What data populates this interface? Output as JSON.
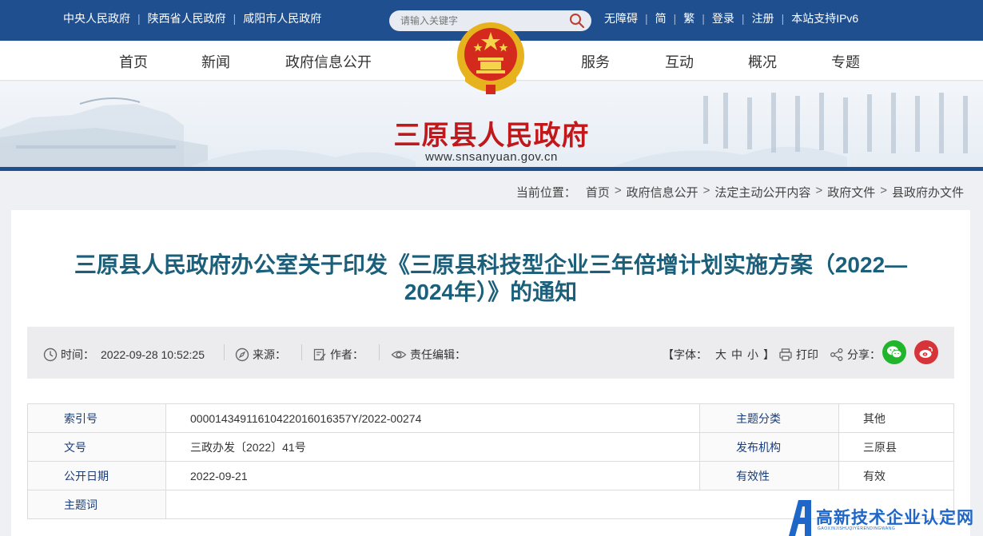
{
  "top_links": [
    "中央人民政府",
    "陕西省人民政府",
    "咸阳市人民政府"
  ],
  "search": {
    "placeholder": "请输入关键字"
  },
  "right_links": [
    "无障碍",
    "简",
    "繁",
    "登录",
    "注册",
    "本站支持IPv6"
  ],
  "nav": {
    "left": [
      "首页",
      "新闻",
      "政府信息公开"
    ],
    "right": [
      "服务",
      "互动",
      "概况",
      "专题"
    ]
  },
  "banner": {
    "title": "三原县人民政府",
    "url": "www.snsanyuan.gov.cn"
  },
  "breadcrumb": {
    "label": "当前位置：",
    "items": [
      "首页",
      "政府信息公开",
      "法定主动公开内容",
      "政府文件",
      "县政府办文件"
    ]
  },
  "article": {
    "title_line1": "三原县人民政府办公室关于印发《三原县科技型企业三年倍增计划实施方案（2022—",
    "title_line2": "2024年）》的通知"
  },
  "meta": {
    "time_label": "时间：",
    "time_value": "2022-09-28 10:52:25",
    "source_label": "来源：",
    "author_label": "作者：",
    "editor_label": "责任编辑：",
    "font_label": "【字体：",
    "font_sizes": [
      "大",
      "中",
      "小"
    ],
    "font_close": "】",
    "print_label": "打印",
    "share_label": "分享："
  },
  "info_table": [
    {
      "label": "索引号",
      "value": "00001434911610422016016357Y/2022-00274",
      "label2": "主题分类",
      "value2": "其他"
    },
    {
      "label": "文号",
      "value": "三政办发〔2022〕41号",
      "label2": "发布机构",
      "value2": "三原县"
    },
    {
      "label": "公开日期",
      "value": "2022-09-21",
      "label2": "有效性",
      "value2": "有效"
    },
    {
      "label": "主题词",
      "value": ""
    }
  ],
  "watermark": {
    "text": "高新技术企业认定网",
    "sub": "GAOXINJISHUQIYERENDINGWANG"
  },
  "colors": {
    "header_blue": "#1f4f8f",
    "title_red": "#c0181b",
    "title_teal": "#1b5f7a",
    "wechat": "#20b52a",
    "weibo": "#d7343a"
  }
}
